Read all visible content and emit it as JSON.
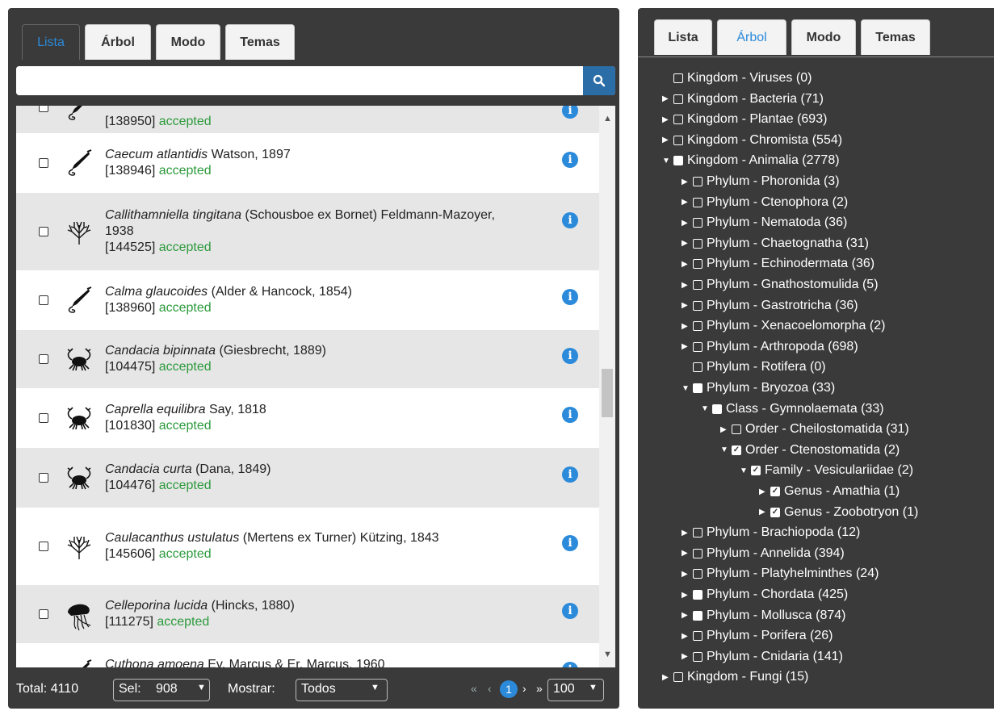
{
  "left_panel": {
    "tabs": [
      {
        "label": "Lista",
        "active": true
      },
      {
        "label": "Árbol",
        "active": false
      },
      {
        "label": "Modo",
        "active": false
      },
      {
        "label": "Temas",
        "active": false
      }
    ],
    "search": {
      "placeholder": "",
      "value": ""
    },
    "rows": [
      {
        "name": "",
        "author": "",
        "id": "[138950]",
        "status": "accepted",
        "icon": "shell-icon"
      },
      {
        "name": "Caecum atlantidis",
        "author": " Watson, 1897",
        "id": "[138946]",
        "status": "accepted",
        "icon": "shell-icon"
      },
      {
        "name": "Callithamniella tingitana",
        "author": " (Schousboe ex Bornet) Feldmann-Mazoyer, 1938",
        "id": "[144525]",
        "status": "accepted",
        "icon": "seaweed-icon"
      },
      {
        "name": "Calma glaucoides",
        "author": " (Alder & Hancock, 1854)",
        "id": "[138960]",
        "status": "accepted",
        "icon": "shell-icon"
      },
      {
        "name": "Candacia bipinnata",
        "author": " (Giesbrecht, 1889)",
        "id": "[104475]",
        "status": "accepted",
        "icon": "crab-icon"
      },
      {
        "name": "Caprella equilibra",
        "author": " Say, 1818",
        "id": "[101830]",
        "status": "accepted",
        "icon": "crab-icon"
      },
      {
        "name": "Candacia curta",
        "author": " (Dana, 1849)",
        "id": "[104476]",
        "status": "accepted",
        "icon": "crab-icon"
      },
      {
        "name": "Caulacanthus ustulatus",
        "author": " (Mertens ex Turner) Kützing, 1843",
        "id": "[145606]",
        "status": "accepted",
        "icon": "seaweed-icon"
      },
      {
        "name": "Celleporina lucida",
        "author": " (Hincks, 1880)",
        "id": "[111275]",
        "status": "accepted",
        "icon": "jellyfish-icon"
      },
      {
        "name": "Cuthona amoena",
        "author": " Ev. Marcus & Er. Marcus, 1960",
        "id": "",
        "status": "",
        "icon": "shell-icon"
      }
    ],
    "footer": {
      "total_label": "Total: 4110",
      "sel_label": "Sel:",
      "sel_value": "908",
      "mostrar_label": "Mostrar:",
      "mostrar_value": "Todos",
      "page_first": "«",
      "page_prev": "‹",
      "page_current": "1",
      "page_next": "›",
      "page_last": "»",
      "page_size": "100"
    }
  },
  "right_panel": {
    "tabs": [
      {
        "label": "Lista",
        "active": false
      },
      {
        "label": "Árbol",
        "active": true
      },
      {
        "label": "Modo",
        "active": false
      },
      {
        "label": "Temas",
        "active": false
      }
    ],
    "tree": [
      {
        "label": "Kingdom - Viruses (0)",
        "depth": 0,
        "arrow": "none",
        "check": "empty"
      },
      {
        "label": "Kingdom - Bacteria (71)",
        "depth": 0,
        "arrow": "right",
        "check": "empty"
      },
      {
        "label": "Kingdom - Plantae (693)",
        "depth": 0,
        "arrow": "right",
        "check": "empty"
      },
      {
        "label": "Kingdom - Chromista (554)",
        "depth": 0,
        "arrow": "right",
        "check": "empty"
      },
      {
        "label": "Kingdom - Animalia (2778)",
        "depth": 0,
        "arrow": "down",
        "check": "filled"
      },
      {
        "label": "Phylum - Phoronida (3)",
        "depth": 1,
        "arrow": "right",
        "check": "empty"
      },
      {
        "label": "Phylum - Ctenophora (2)",
        "depth": 1,
        "arrow": "right",
        "check": "empty"
      },
      {
        "label": "Phylum - Nematoda (36)",
        "depth": 1,
        "arrow": "right",
        "check": "empty"
      },
      {
        "label": "Phylum - Chaetognatha (31)",
        "depth": 1,
        "arrow": "right",
        "check": "empty"
      },
      {
        "label": "Phylum - Echinodermata (36)",
        "depth": 1,
        "arrow": "right",
        "check": "empty"
      },
      {
        "label": "Phylum - Gnathostomulida (5)",
        "depth": 1,
        "arrow": "right",
        "check": "empty"
      },
      {
        "label": "Phylum - Gastrotricha (36)",
        "depth": 1,
        "arrow": "right",
        "check": "empty"
      },
      {
        "label": "Phylum - Xenacoelomorpha (2)",
        "depth": 1,
        "arrow": "right",
        "check": "empty"
      },
      {
        "label": "Phylum - Arthropoda (698)",
        "depth": 1,
        "arrow": "right",
        "check": "empty"
      },
      {
        "label": "Phylum - Rotifera (0)",
        "depth": 1,
        "arrow": "none",
        "check": "empty"
      },
      {
        "label": "Phylum - Bryozoa (33)",
        "depth": 1,
        "arrow": "down",
        "check": "filled"
      },
      {
        "label": "Class - Gymnolaemata (33)",
        "depth": 2,
        "arrow": "down",
        "check": "filled"
      },
      {
        "label": "Order - Cheilostomatida (31)",
        "depth": 3,
        "arrow": "right",
        "check": "empty"
      },
      {
        "label": "Order - Ctenostomatida (2)",
        "depth": 3,
        "arrow": "down",
        "check": "checked"
      },
      {
        "label": "Family - Vesiculariidae (2)",
        "depth": 4,
        "arrow": "down",
        "check": "checked"
      },
      {
        "label": "Genus - Amathia (1)",
        "depth": 5,
        "arrow": "right",
        "check": "checked"
      },
      {
        "label": "Genus - Zoobotryon (1)",
        "depth": 5,
        "arrow": "right",
        "check": "checked"
      },
      {
        "label": "Phylum - Brachiopoda (12)",
        "depth": 1,
        "arrow": "right",
        "check": "empty"
      },
      {
        "label": "Phylum - Annelida (394)",
        "depth": 1,
        "arrow": "right",
        "check": "empty"
      },
      {
        "label": "Phylum - Platyhelminthes (24)",
        "depth": 1,
        "arrow": "right",
        "check": "empty"
      },
      {
        "label": "Phylum - Chordata (425)",
        "depth": 1,
        "arrow": "right",
        "check": "filled"
      },
      {
        "label": "Phylum - Mollusca (874)",
        "depth": 1,
        "arrow": "right",
        "check": "filled"
      },
      {
        "label": "Phylum - Porifera (26)",
        "depth": 1,
        "arrow": "right",
        "check": "empty"
      },
      {
        "label": "Phylum - Cnidaria (141)",
        "depth": 1,
        "arrow": "right",
        "check": "empty"
      },
      {
        "label": "Kingdom - Fungi (15)",
        "depth": 0,
        "arrow": "right",
        "check": "empty"
      }
    ]
  },
  "colors": {
    "accent": "#2b8ad9",
    "accepted": "#2c9a3c",
    "panel": "#3a3a3a"
  }
}
